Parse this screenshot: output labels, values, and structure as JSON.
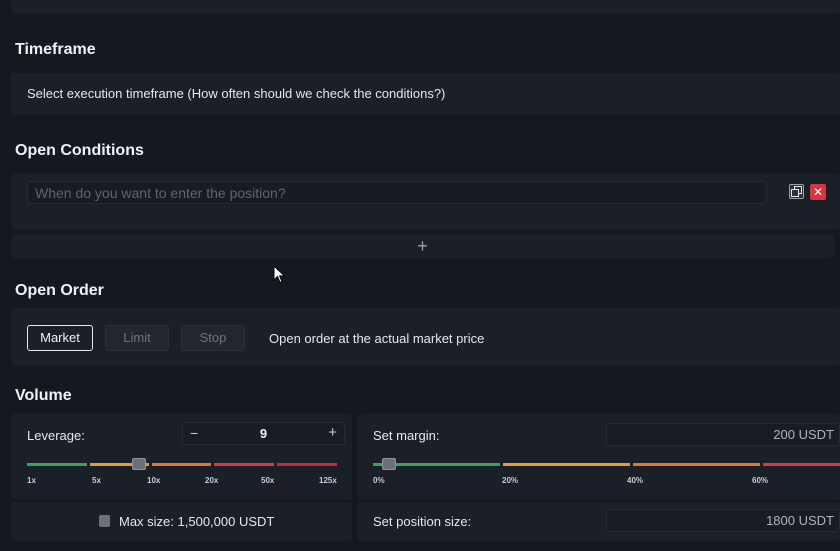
{
  "timeframe": {
    "title": "Timeframe",
    "description": "Select execution timeframe (How often should we check the conditions?)"
  },
  "open_conditions": {
    "title": "Open Conditions",
    "input_placeholder": "When do you want to enter the position?",
    "input_value": "",
    "copy_icon": "copy-icon",
    "close_icon": "close-icon",
    "close_glyph": "✕",
    "add_glyph": "+"
  },
  "open_order": {
    "title": "Open Order",
    "types": [
      "Market",
      "Limit",
      "Stop"
    ],
    "selected": "Market",
    "description": "Open order at the actual market price"
  },
  "volume": {
    "title": "Volume",
    "leverage": {
      "label": "Leverage:",
      "value": "9",
      "minus": "−",
      "plus": "+",
      "ticks": [
        "1x",
        "5x",
        "10x",
        "20x",
        "50x",
        "125x"
      ],
      "colors": [
        "#3aa35a",
        "#e0a030",
        "#e0762f",
        "#d23a47",
        "#c42b3d"
      ]
    },
    "max_size": "Max size: 1,500,000 USDT",
    "margin": {
      "label": "Set margin:",
      "value": "200 USDT",
      "ticks": [
        "0%",
        "20%",
        "40%",
        "60%"
      ],
      "colors": [
        "#3aa35a",
        "#e0a030",
        "#e0762f",
        "#d23a47"
      ]
    },
    "position_size": {
      "label": "Set position size:",
      "value": "1800 USDT"
    }
  }
}
